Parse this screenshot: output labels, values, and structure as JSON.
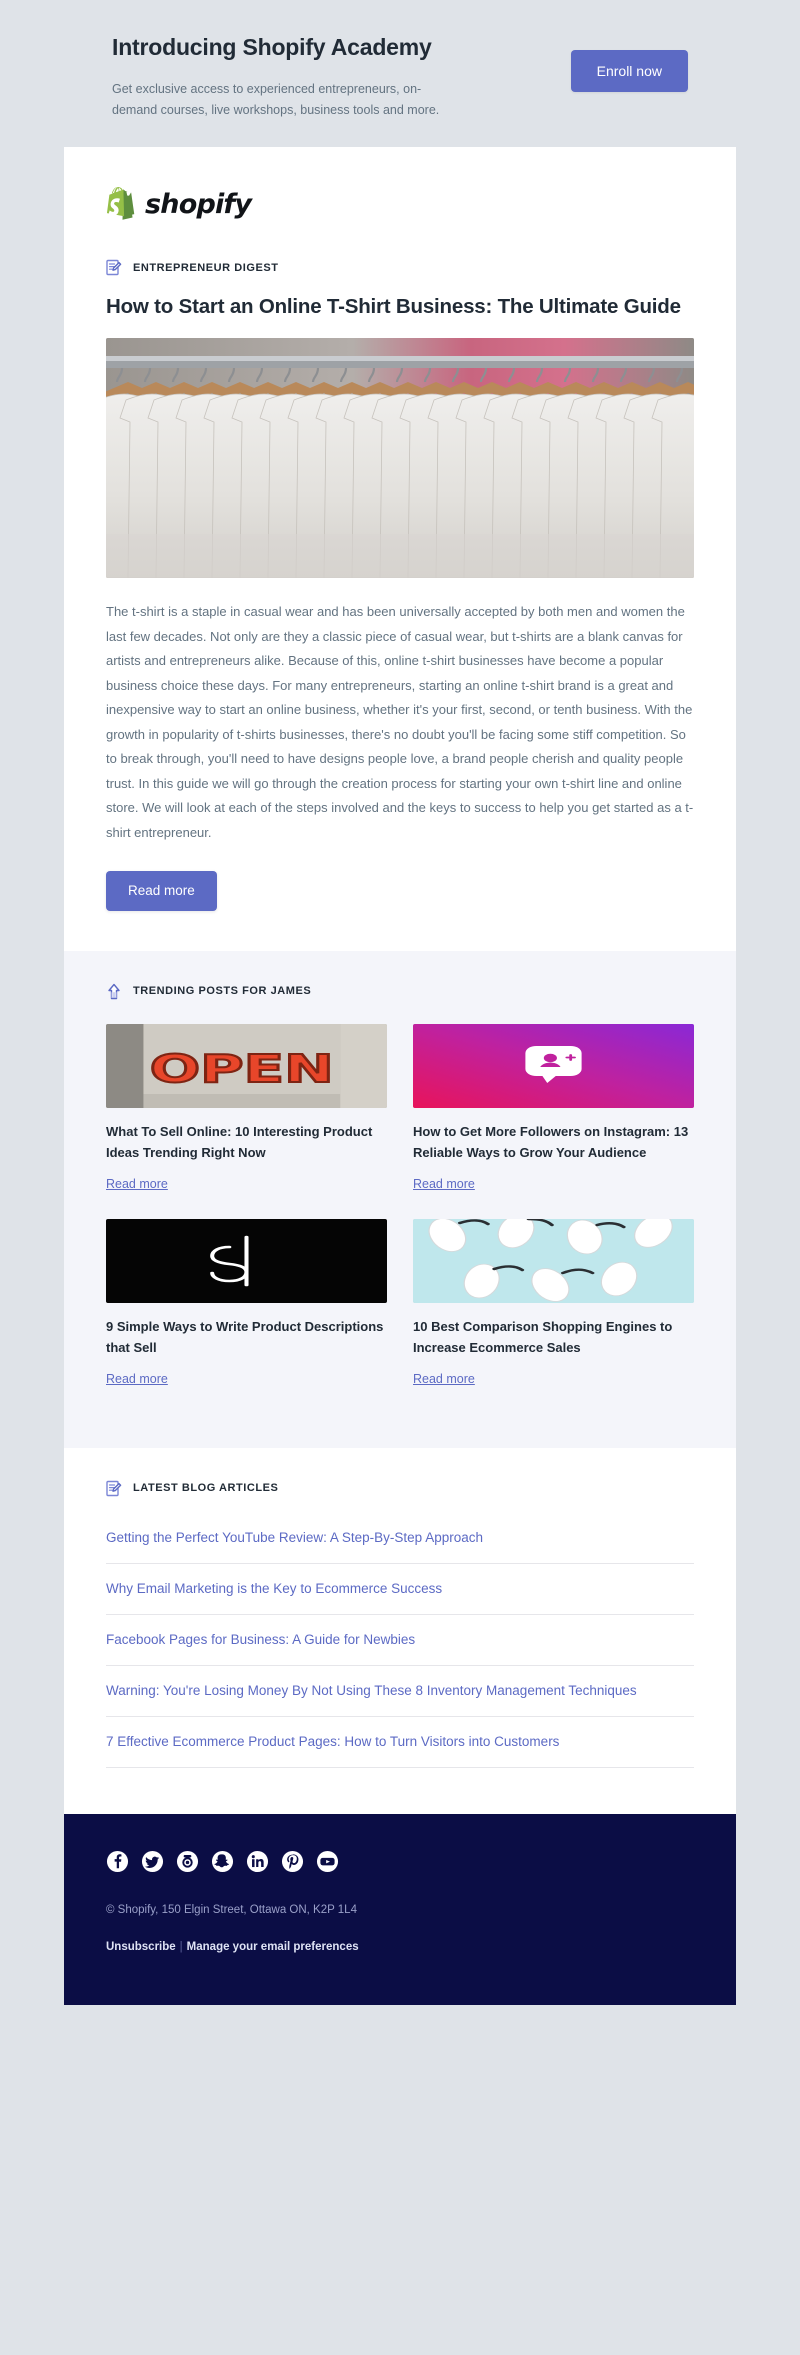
{
  "promo": {
    "title": "Introducing Shopify Academy",
    "subtitle": "Get exclusive access to experienced entrepreneurs, on-demand courses, live workshops, business tools and more.",
    "cta_label": "Enroll now",
    "cta_color": "#5c6ac4"
  },
  "brand": {
    "wordmark": "shopify",
    "logo_icon": "shopify-bag-icon",
    "logo_green": "#95bf47"
  },
  "digest": {
    "eyebrow": "ENTREPRENEUR DIGEST",
    "eyebrow_icon": "document-edit-icon",
    "title": "How to Start an Online T-Shirt Business: The Ultimate Guide",
    "hero_image_alt": "white t-shirts on wooden hangers on a clothing rack",
    "body": "The t-shirt is a staple in casual wear and has been universally accepted by both men and women the last few decades. Not only are they a classic piece of casual wear, but t-shirts are a blank canvas for artists and entrepreneurs alike. Because of this, online t-shirt businesses have become a popular business choice these days. For many entrepreneurs, starting an online t-shirt brand is a great and inexpensive way to start an online business, whether it's your first, second, or tenth business. With the growth in popularity of t-shirts businesses, there's no doubt you'll be facing some stiff competition. So to break through, you'll need to have designs people love, a brand people cherish and quality people trust. In this guide we will go through the creation process for starting your own t-shirt line and online store. We will look at each of the steps involved and the keys to success to help you get started as a t-shirt entrepreneur.",
    "cta_label": "Read more"
  },
  "trending": {
    "eyebrow": "TRENDING POSTS FOR JAMES",
    "eyebrow_icon": "trending-up-icon",
    "link_label": "Read more",
    "cards": [
      {
        "title": "What To Sell Online: 10 Interesting Product Ideas Trending Right Now",
        "link_label": "Read more",
        "thumb_alt": "neon OPEN sign in a shop window"
      },
      {
        "title": "How to Get More Followers on Instagram: 13 Reliable Ways to Grow Your Audience",
        "link_label": "Read more",
        "thumb_alt": "add-follower icon on pink to purple gradient"
      },
      {
        "title": "9 Simple Ways to Write Product Descriptions that Sell",
        "link_label": "Read more",
        "thumb_alt": "white dollar sign outline on black background"
      },
      {
        "title": "10 Best Comparison Shopping Engines to Increase Ecommerce Sales",
        "link_label": "Read more",
        "thumb_alt": "white computer mice on light blue background"
      }
    ]
  },
  "latest": {
    "eyebrow": "LATEST BLOG ARTICLES",
    "eyebrow_icon": "document-edit-icon",
    "articles": [
      "Getting the Perfect YouTube Review: A Step-By-Step Approach",
      "Why Email Marketing is the Key to Ecommerce Success",
      "Facebook Pages for Business: A Guide for Newbies",
      "Warning: You're Losing Money By Not Using These 8 Inventory Management Techniques",
      "7 Effective Ecommerce Product Pages: How to Turn Visitors into Customers"
    ]
  },
  "footer": {
    "background": "#0b0d45",
    "social": [
      {
        "name": "facebook-icon"
      },
      {
        "name": "twitter-icon"
      },
      {
        "name": "instagram-icon"
      },
      {
        "name": "snapchat-icon"
      },
      {
        "name": "linkedin-icon"
      },
      {
        "name": "pinterest-icon"
      },
      {
        "name": "youtube-icon"
      }
    ],
    "legal": "© Shopify,  150 Elgin Street, Ottawa ON, K2P 1L4",
    "unsubscribe_label": "Unsubscribe",
    "separator": "|",
    "preferences_label": "Manage your email preferences"
  }
}
